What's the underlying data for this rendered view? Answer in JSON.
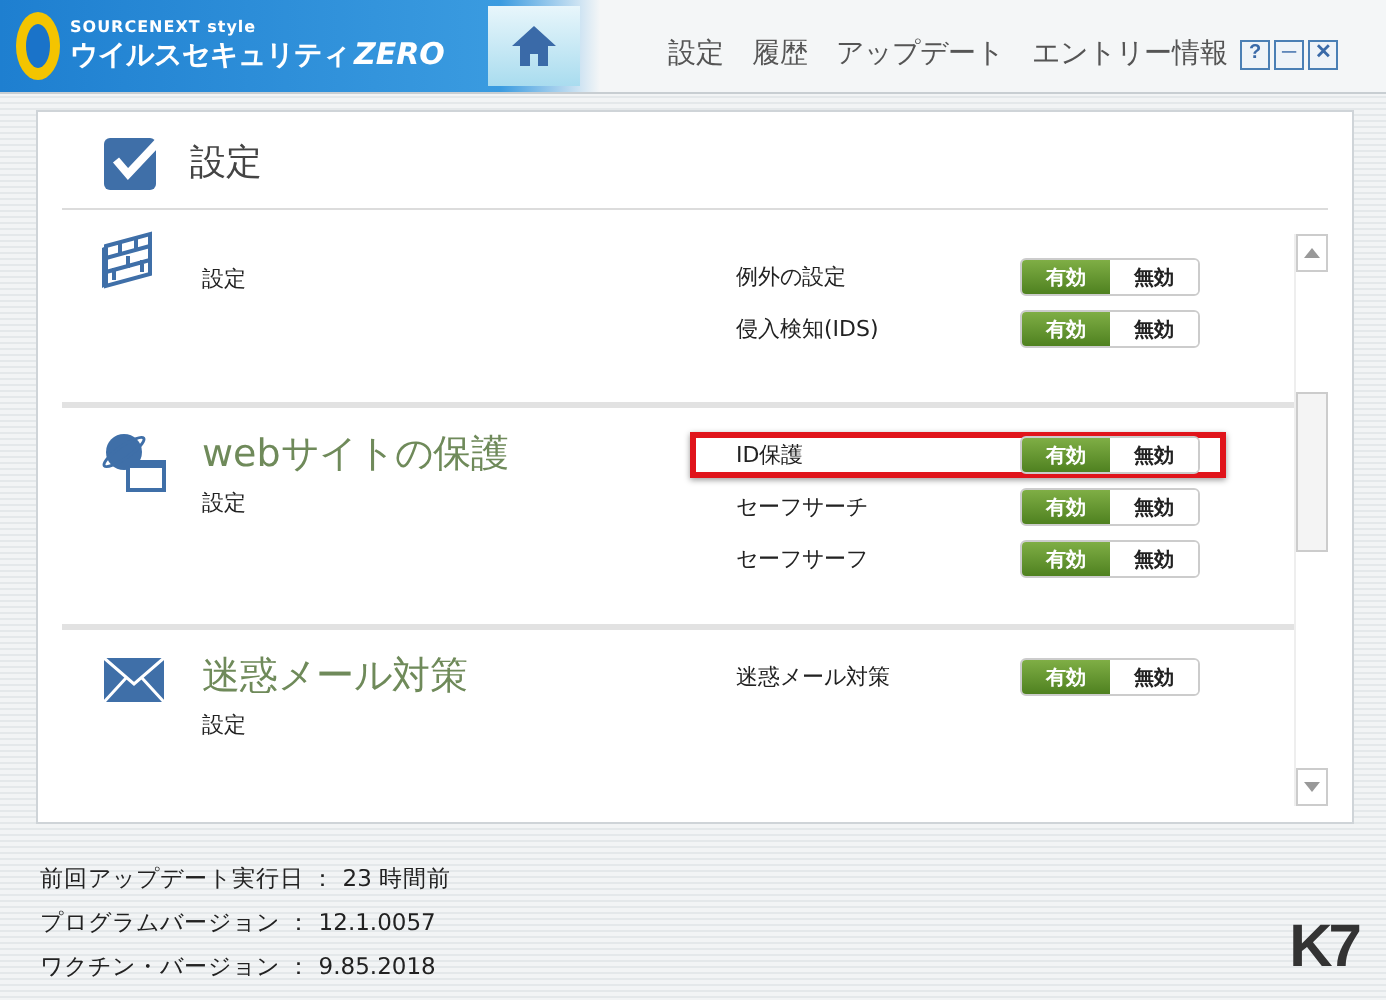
{
  "header": {
    "logo_top": "SOURCENEXT style",
    "logo_main": "ウイルスセキュリティ",
    "logo_suffix": "ZERO",
    "menu": [
      {
        "label": "設定"
      },
      {
        "label": "履歴"
      },
      {
        "label": "アップデート"
      },
      {
        "label": "エントリー情報"
      }
    ],
    "window_buttons": [
      "?",
      "─",
      "✕"
    ]
  },
  "panel": {
    "title": "設定",
    "sections": [
      {
        "kind": "firewall",
        "link": "設定",
        "rows": [
          {
            "label": "例外の設定",
            "on": "有効",
            "off": "無効",
            "enabled": true,
            "highlighted": false
          },
          {
            "label": "侵入検知(IDS)",
            "on": "有効",
            "off": "無効",
            "enabled": true,
            "highlighted": false
          }
        ]
      },
      {
        "kind": "web",
        "title": "webサイトの保護",
        "link": "設定",
        "rows": [
          {
            "label": "ID保護",
            "on": "有効",
            "off": "無効",
            "enabled": true,
            "highlighted": true
          },
          {
            "label": "セーフサーチ",
            "on": "有効",
            "off": "無効",
            "enabled": true,
            "highlighted": false
          },
          {
            "label": "セーフサーフ",
            "on": "有効",
            "off": "無効",
            "enabled": true,
            "highlighted": false
          }
        ]
      },
      {
        "kind": "mail",
        "title": "迷惑メール対策",
        "link": "設定",
        "rows": [
          {
            "label": "迷惑メール対策",
            "on": "有効",
            "off": "無効",
            "enabled": true,
            "highlighted": false
          }
        ]
      }
    ]
  },
  "footer": {
    "lines": [
      "前回アップデート実行日 ： 23 時間前",
      "プログラムバージョン ： 12.1.0057",
      "ワクチン・バージョン ： 9.85.2018"
    ],
    "brand": "K7"
  }
}
